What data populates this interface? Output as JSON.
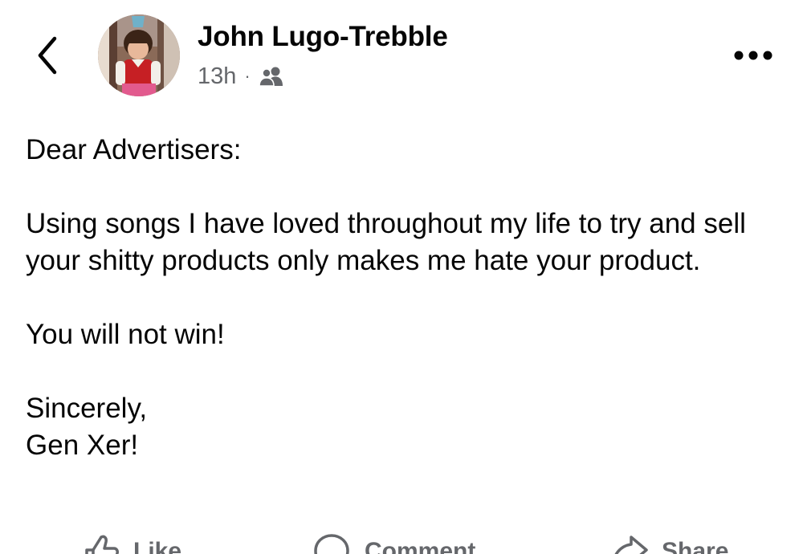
{
  "header": {
    "back_icon": "chevron-left-icon",
    "author_name": "John Lugo-Trebble",
    "timestamp": "13h",
    "separator": "·",
    "audience_icon": "friends-icon",
    "more_icon": "ellipsis-icon"
  },
  "post": {
    "greeting": "Dear Advertisers:",
    "paragraph": "Using songs I have loved throughout my life to try and sell your shitty products only makes me hate your product.",
    "statement": "You will not win!",
    "closing": "Sincerely,",
    "signature": "Gen Xer!"
  },
  "actions": {
    "like_label": "Like",
    "comment_label": "Comment",
    "share_label": "Share"
  },
  "colors": {
    "text_primary": "#050505",
    "text_secondary": "#65676b",
    "background": "#ffffff"
  }
}
